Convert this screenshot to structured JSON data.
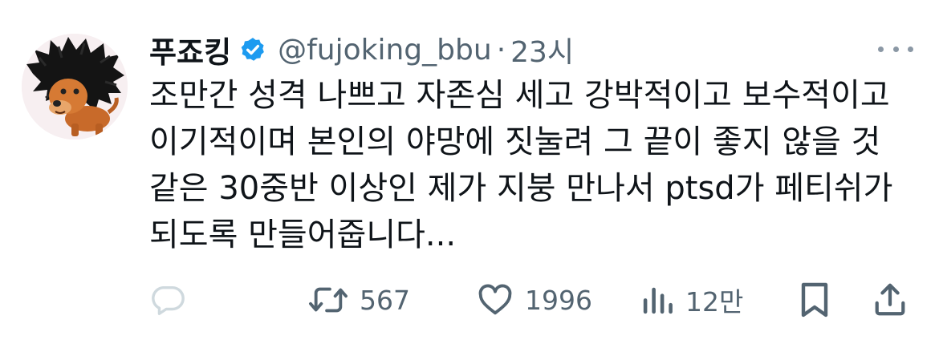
{
  "author": {
    "display_name": "푸죠킹",
    "handle": "@fujoking_bbu",
    "separator": "·",
    "time": "23시"
  },
  "body": {
    "lines": [
      "조만간 성격 나쁘고 자존심 세고 강박적이고 보수적이고",
      "이기적이며 본인의 야망에 짓눌려 그 끝이 좋지 않을 것",
      "같은 30중반 이상인 제가 지붕 만나서 ptsd가 페티쉬가",
      "되도록 만들어줍니다..."
    ]
  },
  "actions": {
    "retweets": "567",
    "likes": "1996",
    "views": "12만"
  },
  "colors": {
    "text": "#0f1419",
    "secondary": "#536471",
    "verified": "#1d9bf0",
    "reply_icon": "#cfd9de"
  },
  "icons": [
    "verified-badge-icon",
    "more-icon",
    "reply-icon",
    "retweet-icon",
    "like-icon",
    "views-icon",
    "bookmark-icon",
    "share-icon"
  ]
}
